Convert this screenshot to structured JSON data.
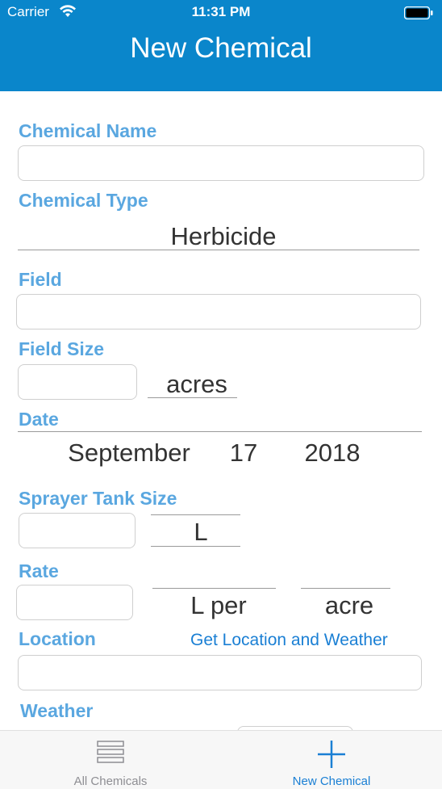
{
  "status_bar": {
    "carrier": "Carrier",
    "time": "11:31 PM"
  },
  "nav": {
    "title": "New Chemical"
  },
  "form": {
    "chemical_name_label": "Chemical Name",
    "chemical_name_value": "",
    "chemical_type_label": "Chemical Type",
    "chemical_type_value": "Herbicide",
    "field_label": "Field",
    "field_value": "",
    "field_size_label": "Field Size",
    "field_size_value": "",
    "field_size_unit": "acres",
    "date_label": "Date",
    "date": {
      "month": "September",
      "day": "17",
      "year": "2018"
    },
    "sprayer_label": "Sprayer Tank Size",
    "sprayer_value": "",
    "sprayer_unit": "L",
    "rate_label": "Rate",
    "rate_value": "",
    "rate_unit": "L per",
    "rate_area_unit": "acre",
    "location_label": "Location",
    "location_action": "Get Location and Weather",
    "location_value": "",
    "weather_label": "Weather"
  },
  "tabbar": {
    "tabs": [
      {
        "label": "All Chemicals",
        "icon": "list-icon",
        "active": false
      },
      {
        "label": "New Chemical",
        "icon": "plus-icon",
        "active": true
      }
    ],
    "active_color": "#1a7fd4",
    "inactive_color": "#8e8e93"
  },
  "colors": {
    "header_bg": "#0a86cb",
    "label": "#5aa7e0",
    "link": "#1a7fd4"
  }
}
